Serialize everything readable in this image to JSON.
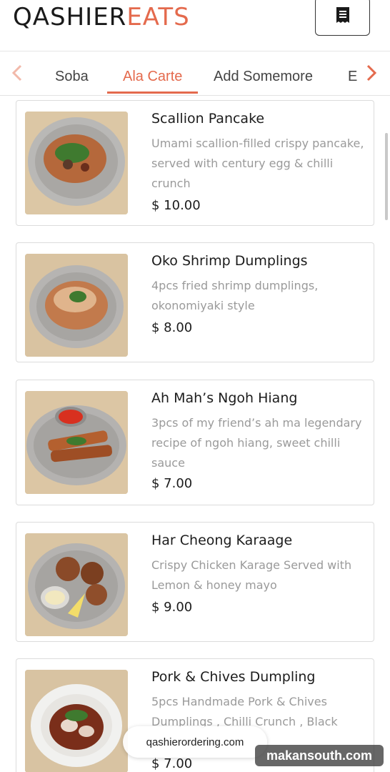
{
  "header": {
    "logo_part1": "QASHIER",
    "logo_part2": "EATS",
    "menu_icon": "receipt-list-icon"
  },
  "tabs": {
    "items": [
      {
        "label": "Soba"
      },
      {
        "label": "Ala Carte",
        "active": true
      },
      {
        "label": "Add Somemore"
      },
      {
        "label": "E"
      }
    ],
    "prev_icon": "chevron-left-icon",
    "next_icon": "chevron-right-icon"
  },
  "menu_items": [
    {
      "name": "Scallion Pancake",
      "description": "Umami scallion-filled crispy pancake, served with century egg & chilli crunch",
      "price": "$ 10.00"
    },
    {
      "name": "Oko Shrimp Dumplings",
      "description": "4pcs fried shrimp dumplings, okonomiyaki style",
      "price": "$ 8.00"
    },
    {
      "name": "Ah Mah’s Ngoh Hiang",
      "description": "3pcs of my friend’s ah ma legendary recipe of ngoh hiang, sweet chilli sauce",
      "price": "$ 7.00"
    },
    {
      "name": "Har Cheong Karaage",
      "description": "Crispy Chicken Karage Served with Lemon & honey mayo",
      "price": "$ 9.00"
    },
    {
      "name": "Pork & Chives Dumpling",
      "description": "5pcs Handmade Pork & Chives Dumplings , Chilli Crunch , Black",
      "price": "$ 7.00"
    }
  ],
  "browser": {
    "url": "qashierordering.com"
  },
  "watermark": {
    "text": "makansouth.com"
  },
  "colors": {
    "accent": "#e46a4d",
    "text": "#1c1c1c",
    "muted": "#9a9a9a"
  }
}
